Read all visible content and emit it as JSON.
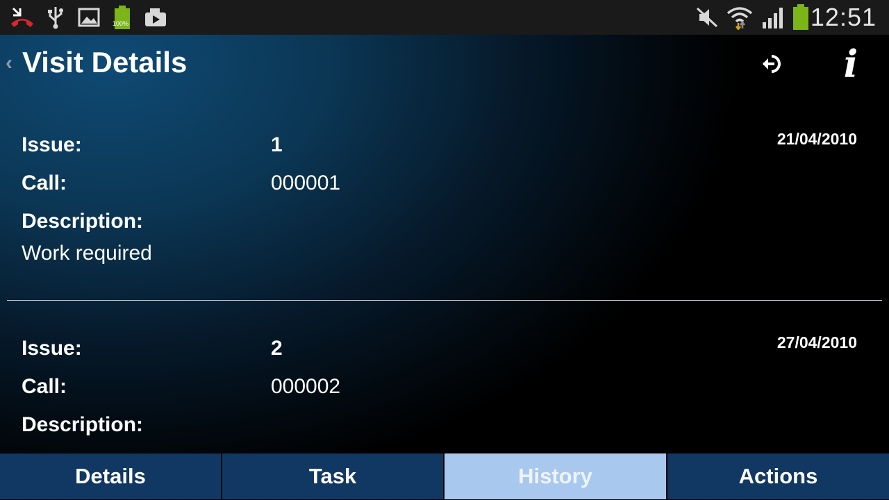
{
  "status_bar": {
    "icons": [
      "missed-call-icon",
      "usb-icon",
      "gallery-icon",
      "battery-full-icon",
      "media-icon"
    ],
    "battery_percent_label": "100%",
    "right_icons": [
      "mute-icon",
      "wifi-icon",
      "signal-icon",
      "battery-icon"
    ],
    "time": "12:51"
  },
  "header": {
    "back_glyph": "‹",
    "title": "Visit Details",
    "logout_icon": "logout-icon",
    "info_icon": "info-icon",
    "info_glyph": "i"
  },
  "issues": [
    {
      "issue_label": "Issue:",
      "issue_value": "1",
      "call_label": "Call:",
      "call_value": "000001",
      "description_label": "Description:",
      "description_value": "Work required",
      "date": "21/04/2010"
    },
    {
      "issue_label": "Issue:",
      "issue_value": "2",
      "call_label": "Call:",
      "call_value": "000002",
      "description_label": "Description:",
      "date": "27/04/2010"
    }
  ],
  "tabs": [
    {
      "label": "Details",
      "active": false
    },
    {
      "label": "Task",
      "active": false
    },
    {
      "label": "History",
      "active": true
    },
    {
      "label": "Actions",
      "active": false
    }
  ],
  "colors": {
    "tab_background": "#113763",
    "tab_active_background": "#a9c8ee",
    "status_bar_background": "#1a1a1a",
    "battery_green": "#7cb518"
  }
}
